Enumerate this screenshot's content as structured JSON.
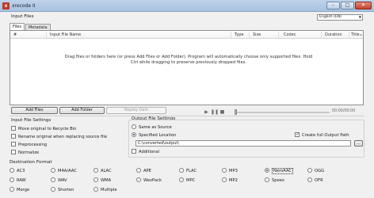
{
  "window": {
    "title": "xrecode II",
    "icon": "xrecode-app-icon",
    "controls": [
      "–",
      "□",
      "✕"
    ]
  },
  "input_files": {
    "section_label": "Input Files",
    "language": "English (EN)",
    "tabs": [
      {
        "label": "Files",
        "active": true
      },
      {
        "label": "Metadata",
        "active": false
      }
    ],
    "columns": [
      "#",
      "Input File Name",
      "Type",
      "Size",
      "Codec",
      "Duration",
      "Title"
    ],
    "drop_hint_line1": "Drag files or folders here (or press Add Files or Add Folder). Program will automatically choose only supported files. Hold",
    "drop_hint_line2": "Ctrl while dragging to preserve previously dropped files."
  },
  "actions": {
    "add_files": "Add Files",
    "add_folder": "Add Folder",
    "replay_gain": "Replay Gain"
  },
  "player": {
    "time": "00:00/00:00"
  },
  "input_file_settings": {
    "label": "Input File Settings",
    "options": [
      {
        "label": "Move original to Recycle Bin",
        "checked": false
      },
      {
        "label": "Rename original when replacing source file",
        "checked": false
      },
      {
        "label": "Preprocessing",
        "checked": false
      },
      {
        "label": "Normalize",
        "checked": false
      }
    ]
  },
  "output_file_settings": {
    "label": "Output File Settings",
    "same_as_source": "Same as Source",
    "specified_location": "Specified Location",
    "selected_mode": "specified_location",
    "create_full_output_path": "Create full Output Path",
    "create_full_output_path_checked": true,
    "output_path": "C:\\converted\\output\\",
    "browse_label": "...",
    "additional": "Additional",
    "additional_checked": false
  },
  "destination_format": {
    "label": "Destination Format",
    "selected": "NeroAAC",
    "rows": [
      [
        "AC3",
        "M4A/AAC",
        "ALAC",
        "APE",
        "FLAC",
        "MP3",
        "NeroAAC",
        "OGG"
      ],
      [
        "RAW",
        "WAV",
        "WMA",
        "WavPack",
        "MPC",
        "MP2",
        "Speex",
        "OFR"
      ],
      [
        "Merge",
        "Shorten",
        "Multiple"
      ]
    ]
  }
}
